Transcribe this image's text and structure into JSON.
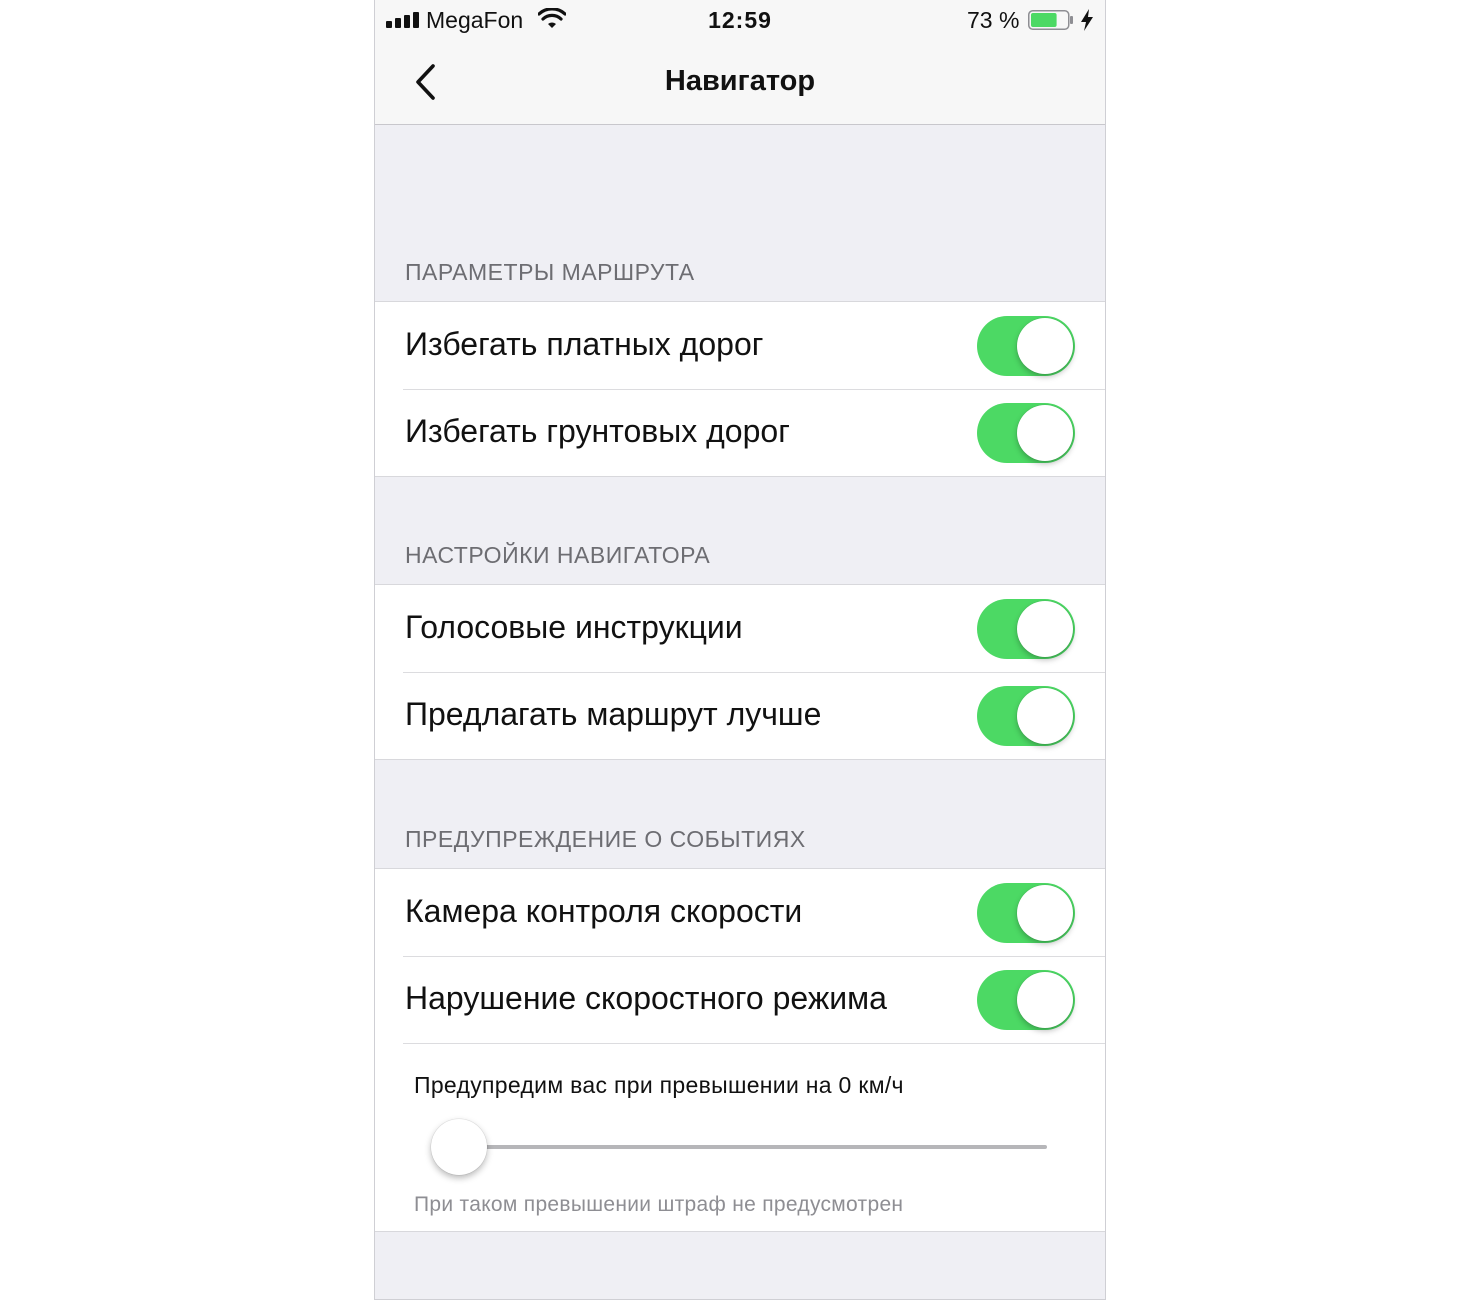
{
  "status_bar": {
    "carrier": "MegaFon",
    "time": "12:59",
    "battery_percent": "73 %",
    "battery_level": 0.73,
    "icons": [
      "signal-icon",
      "wifi-icon",
      "battery-icon",
      "charging-bolt-icon"
    ]
  },
  "nav": {
    "title": "Навигатор",
    "back_icon": "chevron-left-icon"
  },
  "sections": [
    {
      "header": "ПАРАМЕТРЫ МАРШРУТА",
      "rows": [
        {
          "label": "Избегать платных дорог",
          "on": true
        },
        {
          "label": "Избегать грунтовых дорог",
          "on": true
        }
      ]
    },
    {
      "header": "НАСТРОЙКИ НАВИГАТОРА",
      "rows": [
        {
          "label": "Голосовые инструкции",
          "on": true
        },
        {
          "label": "Предлагать маршрут лучше",
          "on": true
        }
      ]
    },
    {
      "header": "ПРЕДУПРЕЖДЕНИЕ О СОБЫТИЯХ",
      "rows": [
        {
          "label": "Камера контроля скорости",
          "on": true
        },
        {
          "label": "Нарушение скоростного режима",
          "on": true
        }
      ]
    }
  ],
  "speed_warning": {
    "title": "Предупредим вас при превышении на 0 км/ч",
    "slider_value": 0,
    "note": "При таком превышении штраф не предусмотрен"
  },
  "colors": {
    "toggle_on": "#4cd964",
    "background": "#efeff4",
    "header_text": "#6d6d72"
  }
}
